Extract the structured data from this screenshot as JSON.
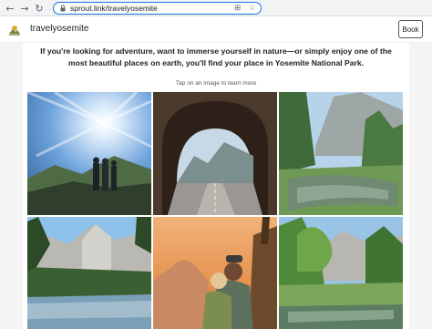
{
  "browser": {
    "url": "sprout.link/travelyosemite",
    "back_icon": "arrow-left-icon",
    "forward_icon": "arrow-right-icon",
    "reload_icon": "reload-icon",
    "lock_icon": "lock-icon",
    "install_icon": "install-app-icon",
    "star_icon": "star-icon"
  },
  "header": {
    "brand_name": "travelyosemite",
    "book_label": "Book"
  },
  "main": {
    "intro": "If you're looking for adventure, want to immerse yourself in nature—or simply enjoy one of the most beautiful places on earth, you'll find your place in Yosemite National Park.",
    "hint": "Tap on an image to learn more"
  },
  "colors": {
    "accent": "#1a73e8",
    "chrome_bg": "#f1f3f4",
    "side_gutter": "#f4f4f4"
  },
  "tiles": [
    {
      "name": "photo-hikers-sunburst",
      "subject": "hikers under sunburst"
    },
    {
      "name": "photo-tunnel-view",
      "subject": "tunnel view road"
    },
    {
      "name": "photo-river-valley",
      "subject": "river and cliffs"
    },
    {
      "name": "photo-el-capitan-meadow",
      "subject": "meadow and granite cliffs"
    },
    {
      "name": "photo-couple-half-dome",
      "subject": "couple with half dome at sunset"
    },
    {
      "name": "photo-valley-trees",
      "subject": "valley trees and reflection"
    }
  ]
}
